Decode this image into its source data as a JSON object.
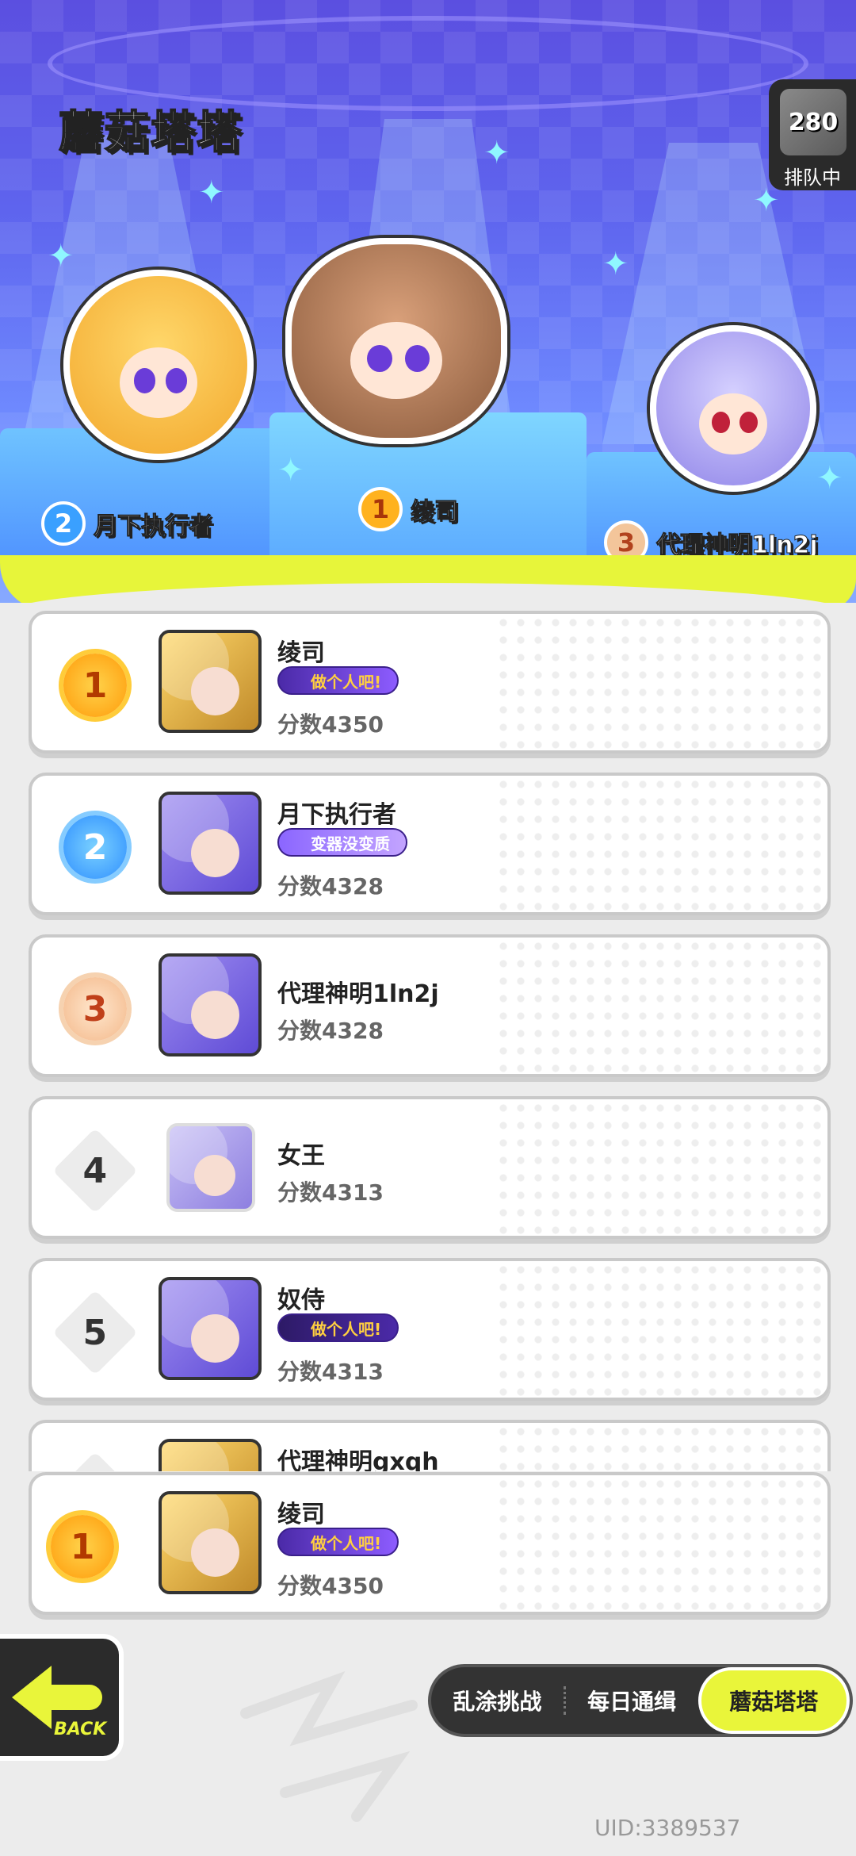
{
  "header": {
    "title": "蘑菇塔塔",
    "queue": {
      "count": "280",
      "label": "排队中"
    }
  },
  "podium": [
    {
      "rank": "2",
      "name": "月下执行者"
    },
    {
      "rank": "1",
      "name": "绫司"
    },
    {
      "rank": "3",
      "name": "代理神明1ln2j"
    }
  ],
  "leaderboard": [
    {
      "rank": "1",
      "name": "绫司",
      "tag": "做个人吧!",
      "score": "分数4350"
    },
    {
      "rank": "2",
      "name": "月下执行者",
      "tag": "变器没变质",
      "score": "分数4328"
    },
    {
      "rank": "3",
      "name": "代理神明1ln2j",
      "tag": "",
      "score": "分数4328"
    },
    {
      "rank": "4",
      "name": "女王",
      "tag": "",
      "score": "分数4313"
    },
    {
      "rank": "5",
      "name": "奴侍",
      "tag": "做个人吧!",
      "score": "分数4313"
    },
    {
      "rank": "",
      "name": "代理神明gxqh",
      "tag": "",
      "score": ""
    }
  ],
  "self_entry": {
    "rank": "1",
    "name": "绫司",
    "tag": "做个人吧!",
    "score": "分数4350"
  },
  "back_button": {
    "label": "BACK"
  },
  "tabs": [
    {
      "label": "乱涂挑战",
      "active": false
    },
    {
      "label": "每日通缉",
      "active": false
    },
    {
      "label": "蘑菇塔塔",
      "active": true
    }
  ],
  "footer": {
    "uid": "UID:3389537"
  },
  "colors": {
    "accent": "#e9f53a",
    "stage": "#5e64ee",
    "gold": "#ffb21f"
  }
}
